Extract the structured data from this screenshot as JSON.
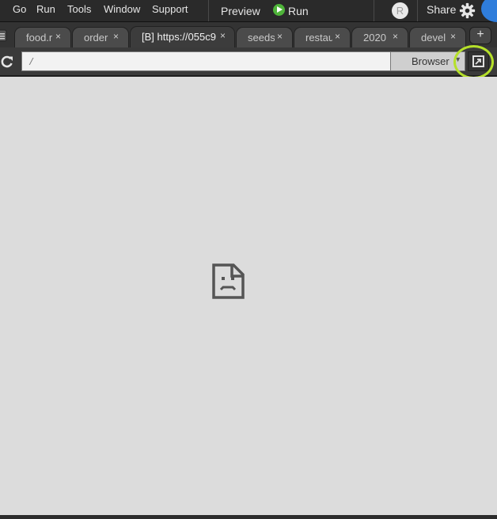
{
  "menubar": {
    "items": [
      "Go",
      "Run",
      "Tools",
      "Window",
      "Support"
    ],
    "preview_label": "Preview",
    "run_label": "Run",
    "avatar_letter": "R",
    "share_label": "Share"
  },
  "tabs": [
    {
      "label": "food.r",
      "active": false
    },
    {
      "label": "order",
      "active": false
    },
    {
      "label": "[B] https://055c9",
      "active": true
    },
    {
      "label": "seeds",
      "active": false
    },
    {
      "label": "restau",
      "active": false
    },
    {
      "label": "2020",
      "active": false
    },
    {
      "label": "devel",
      "active": false
    }
  ],
  "close_glyph": "×",
  "new_tab_glyph": "+",
  "address": {
    "url_value": "/",
    "browser_select_value": "Browser"
  },
  "colors": {
    "run_green": "#4fb43a",
    "highlight_ring": "#b5e02a",
    "accent_blue": "#2f7ddb"
  },
  "icons": [
    "tab-list-icon",
    "reload-icon",
    "play-icon",
    "gear-icon",
    "popout-icon",
    "sad-page-icon"
  ]
}
